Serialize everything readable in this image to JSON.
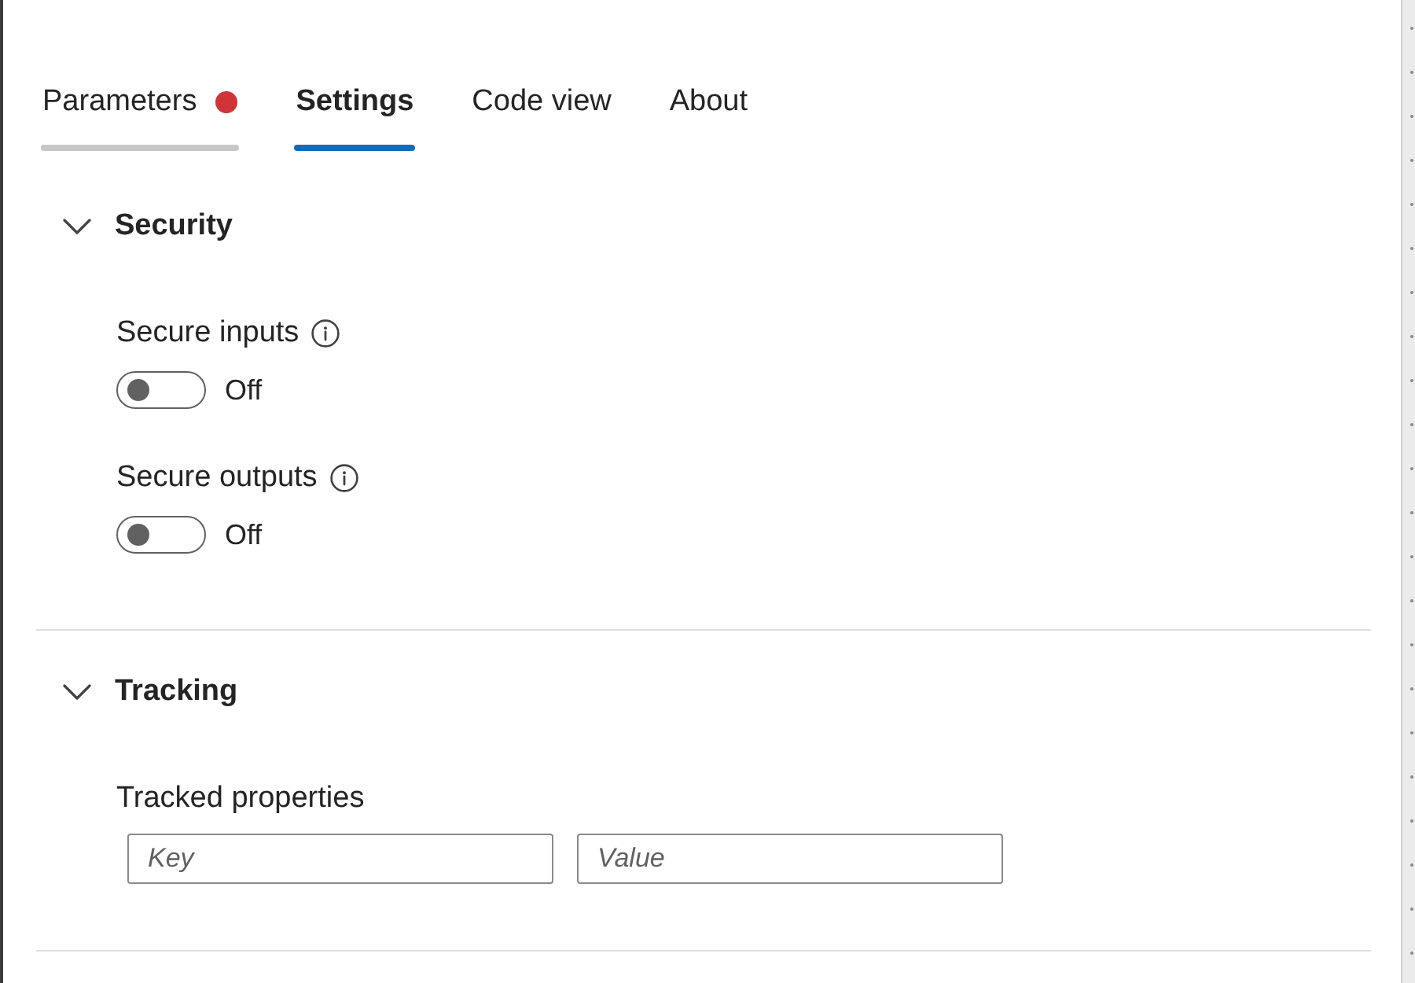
{
  "tabs": [
    {
      "label": "Parameters",
      "selected": false,
      "hovered": true,
      "has_error": true
    },
    {
      "label": "Settings",
      "selected": true,
      "hovered": false,
      "has_error": false
    },
    {
      "label": "Code view",
      "selected": false,
      "hovered": false,
      "has_error": false
    },
    {
      "label": "About",
      "selected": false,
      "hovered": false,
      "has_error": false
    }
  ],
  "sections": [
    {
      "title": "Security",
      "expanded": true,
      "settings": [
        {
          "kind": "toggle",
          "label": "Secure inputs",
          "info": true,
          "on": false,
          "state_text": "Off"
        },
        {
          "kind": "toggle",
          "label": "Secure outputs",
          "info": true,
          "on": false,
          "state_text": "Off"
        }
      ]
    },
    {
      "title": "Tracking",
      "expanded": true,
      "settings": [
        {
          "kind": "key_value",
          "label": "Tracked properties",
          "info": false,
          "key_placeholder": "Key",
          "value_placeholder": "Value"
        }
      ]
    }
  ]
}
